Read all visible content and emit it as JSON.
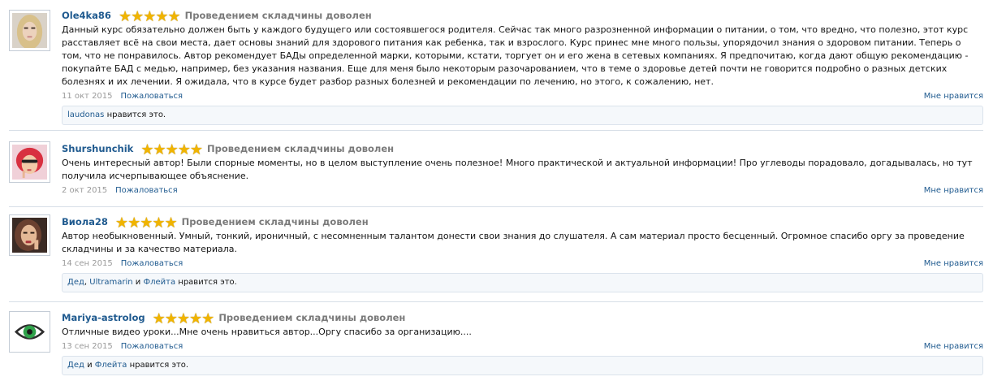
{
  "reviews": [
    {
      "username": "Ole4ka86",
      "rating_text": "Проведением складчины доволен",
      "stars": 5,
      "text": "Данный курс обязательно должен быть у каждого будущего или состоявшегося родителя. Сейчас так много разрозненной информации о питании, о том, что вредно, что полезно, этот курс расставляет всё на свои места, дает основы знаний для здорового питания как ребенка, так и взрослого. Курс принес мне много пользы, упорядочил знания о здоровом питании. Теперь о том, что не понравилось. Автор рекомендует БАДы определенной марки, которыми, кстати, торгует он и его жена в сетевых компаниях. Я предпочитаю, когда дают общую рекомендацию - покупайте БАД с медью, например, без указания названия. Еще для меня было некоторым разочарованием, что в теме о здоровье детей почти не говорится подробно о разных детских болезнях и их лечении. Я ожидала, что в курсе будет разбор разных болезней и рекомендации по лечению, но этого, к сожалению, нет.",
      "date": "11 окт 2015",
      "report_label": "Пожаловаться",
      "like_label": "Мне нравится",
      "likers": [
        "laudonas"
      ],
      "likes_suffix": "нравится это."
    },
    {
      "username": "Shurshunchik",
      "rating_text": "Проведением складчины доволен",
      "stars": 5,
      "text": "Очень интересный автор! Были спорные моменты, но в целом выступление очень полезное! Много практической и актуальной информации! Про углеводы порадовало, догадывалась, но тут получила исчерпывающее объяснение.",
      "date": "2 окт 2015",
      "report_label": "Пожаловаться",
      "like_label": "Мне нравится"
    },
    {
      "username": "Виола28",
      "rating_text": "Проведением складчины доволен",
      "stars": 5,
      "text": "Автор необыкновенный. Умный, тонкий, ироничный, с несомненным талантом донести свои знания до слушателя. А сам материал просто бесценный. Огромное спасибо оргу за проведение складчины и за качество материала.",
      "date": "14 сен 2015",
      "report_label": "Пожаловаться",
      "like_label": "Мне нравится",
      "likers": [
        "Дед",
        "Ultramarin",
        "Флейта"
      ],
      "likes_and": "и",
      "likes_suffix": "нравится это."
    },
    {
      "username": "Mariya-astrolog",
      "rating_text": "Проведением складчины доволен",
      "stars": 5,
      "text": "Отличные видео уроки...Мне очень нравиться автор...Оргу спасибо за организацию....",
      "date": "13 сен 2015",
      "report_label": "Пожаловаться",
      "like_label": "Мне нравится",
      "likers": [
        "Дед",
        "Флейта"
      ],
      "likes_and": "и",
      "likes_suffix": "нравится это."
    }
  ],
  "colors": {
    "link": "#1f5a8f",
    "star": "#f0b400",
    "muted": "#9a9a9a",
    "likes_bg": "#f5f8fb"
  },
  "icons": [
    "avatar-blonde-portrait",
    "avatar-red-hair-portrait",
    "avatar-dark-hair-portrait",
    "avatar-eye-icon",
    "star-icon"
  ]
}
